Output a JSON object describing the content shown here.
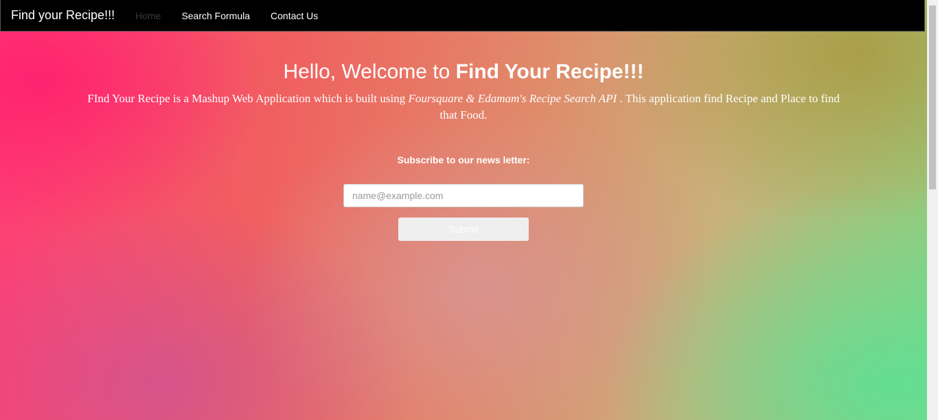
{
  "navbar": {
    "brand": "Find your Recipe!!!",
    "links": [
      {
        "label": "Home",
        "active": true
      },
      {
        "label": "Search Formula",
        "active": false
      },
      {
        "label": "Contact Us",
        "active": false
      }
    ]
  },
  "hero": {
    "welcome_prefix": "Hello, Welcome to ",
    "welcome_emphasis": "Find Your Recipe!!!",
    "desc_prefix": "FInd Your Recipe is a Mashup Web Application which is built using ",
    "desc_italic": "Foursquare & Edamam's Recipe Search API",
    "desc_suffix": " . This application find Recipe and Place to find that Food."
  },
  "subscribe": {
    "label": "Subscribe to our news letter:",
    "email_placeholder": "name@example.com",
    "email_value": "",
    "submit_label": "Submit"
  },
  "colors": {
    "navbar_bg": "#000000",
    "active_link": "#3b3b3b",
    "gradient_pink": "#ff3b78",
    "gradient_green": "#8fcf7e"
  }
}
